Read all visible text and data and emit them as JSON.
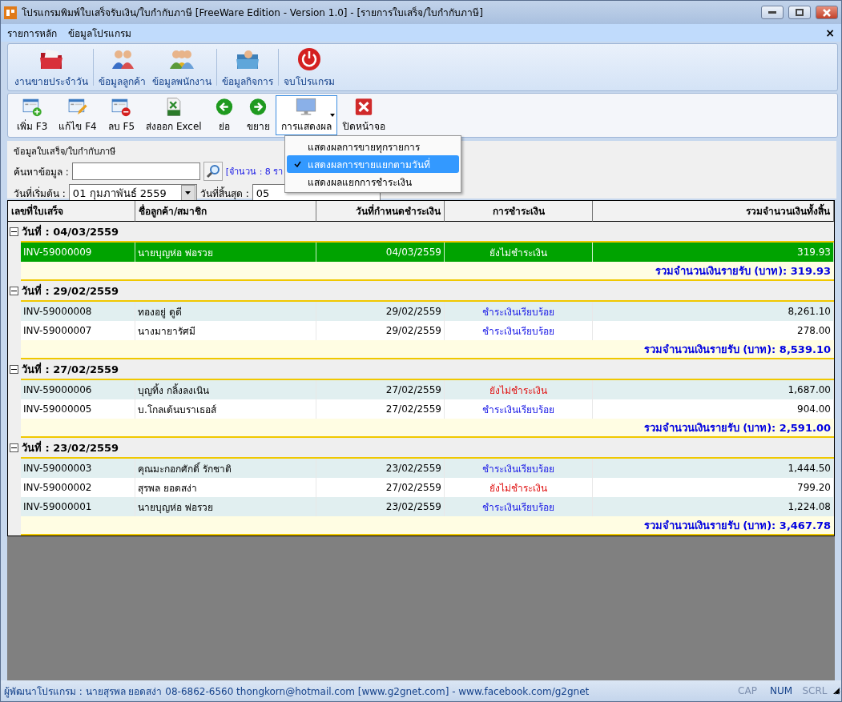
{
  "window": {
    "title": "โปรแกรมพิมพ์ใบเสร็จรับเงิน/ใบกำกับภาษี [FreeWare Edition - Version 1.0] - [รายการใบเสร็จ/ใบกำกับภาษี]"
  },
  "menu": [
    "รายการหลัก",
    "ข้อมูลโปรแกรม"
  ],
  "menu_close": "×",
  "main_toolbar": [
    {
      "label": "งานขายประจำวัน"
    },
    {
      "label": "ข้อมูลลูกค้า"
    },
    {
      "label": "ข้อมูลพนักงาน"
    },
    {
      "label": "ข้อมูลกิจการ"
    },
    {
      "label": "จบโปรแกรม"
    }
  ],
  "toolbar": [
    {
      "label": "เพิ่ม F3",
      "kind": "button"
    },
    {
      "label": "แก้ไข F4",
      "kind": "button"
    },
    {
      "label": "ลบ F5",
      "kind": "button"
    },
    {
      "label": "ส่งออก Excel",
      "kind": "button"
    },
    {
      "label": "ย่อ",
      "kind": "button"
    },
    {
      "label": "ขยาย",
      "kind": "button"
    },
    {
      "label": "การแสดงผล",
      "kind": "dropdown",
      "expanded": true
    },
    {
      "label": "ปิดหน้าจอ",
      "kind": "button"
    }
  ],
  "display_menu": [
    {
      "label": "แสดงผลการขายทุกรายการ",
      "selected": false
    },
    {
      "label": "แสดงผลการขายแยกตามวันที่",
      "selected": true
    },
    {
      "label": "แสดงผลแยกการชำระเงิน",
      "selected": false
    }
  ],
  "filter": {
    "group_title": "ข้อมูลใบเสร็จ/ใบกำกับภาษี",
    "search_label": "ค้นหาข้อมูล :",
    "count": "[จำนวน : 8 รา",
    "start_label": "วันที่เริ่มต้น :",
    "start_value": "01  กุมภาพันธ์  2559",
    "end_label": "วันที่สิ้นสุด :",
    "end_value": "05"
  },
  "table": {
    "columns": [
      "เลขที่ใบเสร็จ",
      "ชื่อลูกค้า/สมาชิก",
      "วันที่กำหนดชำระเงิน",
      "การชำระเงิน",
      "รวมจำนวนเงินทั้งสิ้น"
    ],
    "groups": [
      {
        "title": "วันที่ : 04/03/2559",
        "expanded": true,
        "total": "รวมจำนวนเงินรายรับ (บาท): 319.93",
        "rows": [
          {
            "no": "INV-59000009",
            "customer": "นายบุญห่อ พ่อรวย",
            "due": "04/03/2559",
            "payment": "ยังไม่ชำระเงิน",
            "paid": false,
            "amount": "319.93",
            "selected": true
          }
        ]
      },
      {
        "title": "วันที่ : 29/02/2559",
        "expanded": true,
        "total": "รวมจำนวนเงินรายรับ (บาท): 8,539.10",
        "rows": [
          {
            "no": "INV-59000008",
            "customer": "ทองอยู่ ดูดี",
            "due": "29/02/2559",
            "payment": "ชำระเงินเรียบร้อย",
            "paid": true,
            "amount": "8,261.10",
            "selected": false
          },
          {
            "no": "INV-59000007",
            "customer": "นางมายารัศมี",
            "due": "29/02/2559",
            "payment": "ชำระเงินเรียบร้อย",
            "paid": true,
            "amount": "278.00",
            "selected": false
          }
        ]
      },
      {
        "title": "วันที่ : 27/02/2559",
        "expanded": true,
        "total": "รวมจำนวนเงินรายรับ (บาท): 2,591.00",
        "rows": [
          {
            "no": "INV-59000006",
            "customer": "บุญทิ้ง กลิ้งลงเนิน",
            "due": "27/02/2559",
            "payment": "ยังไม่ชำระเงิน",
            "paid": false,
            "amount": "1,687.00",
            "selected": false
          },
          {
            "no": "INV-59000005",
            "customer": "บ.โกลเด้นบราเธอส์",
            "due": "27/02/2559",
            "payment": "ชำระเงินเรียบร้อย",
            "paid": true,
            "amount": "904.00",
            "selected": false
          }
        ]
      },
      {
        "title": "วันที่ : 23/02/2559",
        "expanded": true,
        "total": "รวมจำนวนเงินรายรับ (บาท): 3,467.78",
        "rows": [
          {
            "no": "INV-59000003",
            "customer": "คุณมะกอกศักดิ์ รักชาติ",
            "due": "23/02/2559",
            "payment": "ชำระเงินเรียบร้อย",
            "paid": true,
            "amount": "1,444.50",
            "selected": false
          },
          {
            "no": "INV-59000002",
            "customer": "สุรพล ยอดสง่า",
            "due": "27/02/2559",
            "payment": "ยังไม่ชำระเงิน",
            "paid": false,
            "amount": "799.20",
            "selected": false
          },
          {
            "no": "INV-59000001",
            "customer": "นายบุญห่อ พ่อรวย",
            "due": "23/02/2559",
            "payment": "ชำระเงินเรียบร้อย",
            "paid": true,
            "amount": "1,224.08",
            "selected": false
          }
        ]
      }
    ]
  },
  "status_bar": {
    "text": "ผู้พัฒนาโปรแกรม : นายสุรพล ยอดสง่า 08-6862-6560 thongkorn@hotmail.com [www.g2gnet.com] - www.facebook.com/g2gnet",
    "keys": [
      {
        "label": "CAP",
        "on": false
      },
      {
        "label": "NUM",
        "on": true
      },
      {
        "label": "SCRL",
        "on": false
      }
    ]
  }
}
